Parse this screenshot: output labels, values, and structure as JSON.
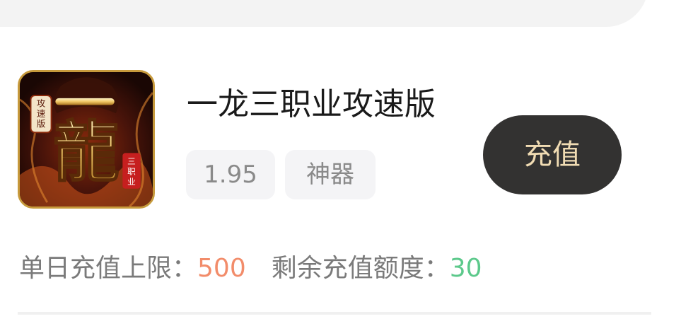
{
  "game": {
    "title": "一龙三职业攻速版",
    "icon": {
      "name": "game-logo-dragon",
      "main_character": "龍",
      "top_character": "一",
      "badge_text": "攻速版",
      "corner_text": "三职业"
    },
    "tags": {
      "discount": "1.95",
      "category": "神器"
    }
  },
  "actions": {
    "recharge_label": "充值"
  },
  "limits": {
    "daily_label": "单日充值上限：",
    "daily_value": "500",
    "remaining_label": "剩余充值额度：",
    "remaining_value": "30"
  },
  "colors": {
    "button_bg": "#333231",
    "button_text": "#f1dcb3",
    "daily_value": "#f28c6a",
    "remaining_value": "#5cc98b",
    "tag_bg": "#f4f4f6"
  }
}
